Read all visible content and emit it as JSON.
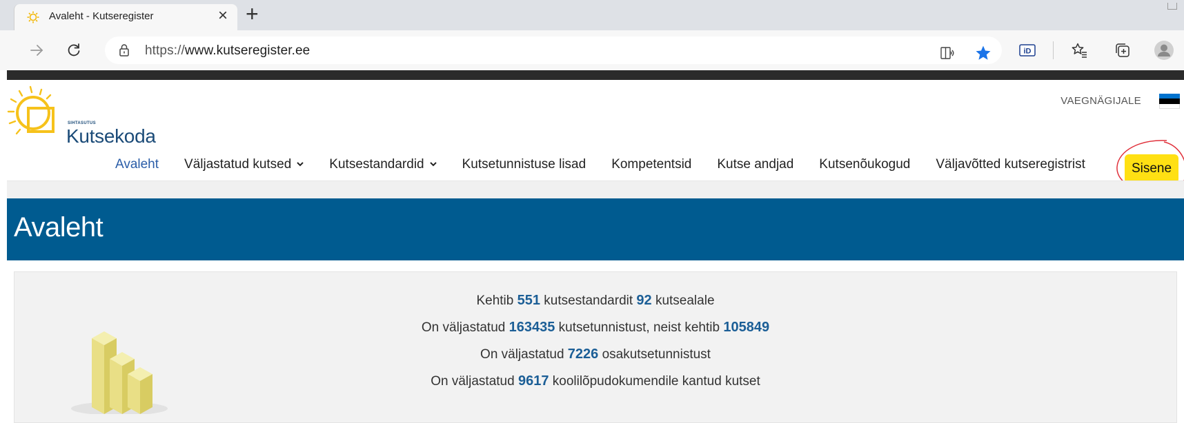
{
  "browser": {
    "tab_title": "Avaleht - Kutseregister",
    "tab_close": "×",
    "new_tab": "+",
    "url_prefix": "https://",
    "url_domain": "www.kutseregister.ee",
    "icons": [
      "back-arrow-icon",
      "reload-icon",
      "lock-icon",
      "immersive-reader-icon",
      "favorite-star-icon",
      "id-extension-icon",
      "favorites-list-icon",
      "collections-icon",
      "profile-icon"
    ],
    "id_ext_label": "iD",
    "accent_star": "#1a73e8"
  },
  "header": {
    "logo_small": "SIHTASUTUS",
    "logo_name": "Kutsekoda",
    "lang_link": "VAEGNÄGIJALE",
    "flag_colors": [
      "#0072ce",
      "#000000",
      "#ffffff"
    ]
  },
  "nav": {
    "items": [
      {
        "label": "Avaleht",
        "active": true
      },
      {
        "label": "Väljastatud kutsed",
        "dropdown": true
      },
      {
        "label": "Kutsestandardid",
        "dropdown": true
      },
      {
        "label": "Kutsetunnistuse lisad"
      },
      {
        "label": "Kompetentsid"
      },
      {
        "label": "Kutse andjad"
      },
      {
        "label": "Kutsenõukogud"
      },
      {
        "label": "Väljavõtted kutseregistrist"
      }
    ],
    "login_label": "Sisene",
    "login_color": "#ffe013"
  },
  "hero": {
    "title": "Avaleht",
    "color": "#005b90"
  },
  "stats": {
    "line1": {
      "a": "Kehtib",
      "n1": "551",
      "b": "kutsestandardit",
      "n2": "92",
      "c": "kutsealale"
    },
    "line2": {
      "a": "On väljastatud",
      "n1": "163435",
      "b": "kutsetunnistust, neist kehtib",
      "n2": "105849"
    },
    "line3": {
      "a": "On väljastatud",
      "n1": "7226",
      "b": "osakutsetunnistust"
    },
    "line4": {
      "a": "On väljastatud",
      "n1": "9617",
      "b": "koolilõpudokumendile kantud kutset"
    }
  }
}
